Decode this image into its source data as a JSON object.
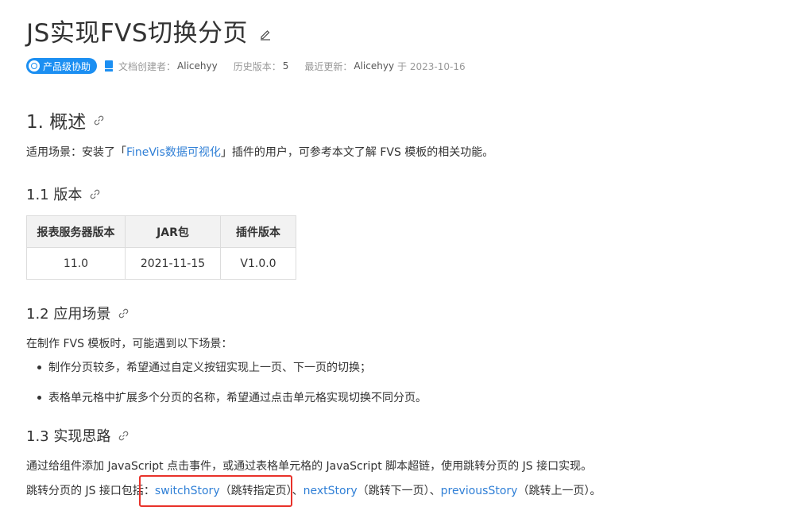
{
  "title": "JS实现FVS切换分页",
  "meta": {
    "badge": "产品级协助",
    "creator_label": "文档创建者：",
    "creator": "Alicehyy",
    "history_label": "历史版本：",
    "history": "5",
    "updated_label": "最近更新：",
    "updated_by": "Alicehyy",
    "updated_at": "于 2023-10-16"
  },
  "section1": {
    "heading": "1. 概述",
    "intro_prefix": "适用场景：安装了「",
    "intro_link": "FineVis数据可视化",
    "intro_suffix": "」插件的用户，可参考本文了解 FVS 模板的相关功能。"
  },
  "section1_1": {
    "heading": "1.1 版本",
    "table": {
      "headers": [
        "报表服务器版本",
        "JAR包",
        "插件版本"
      ],
      "rows": [
        [
          "11.0",
          "2021-11-15",
          "V1.0.0"
        ]
      ]
    }
  },
  "section1_2": {
    "heading": "1.2 应用场景",
    "intro": "在制作 FVS 模板时，可能遇到以下场景：",
    "items": [
      "制作分页较多，希望通过自定义按钮实现上一页、下一页的切换；",
      "表格单元格中扩展多个分页的名称，希望通过点击单元格实现切换不同分页。"
    ]
  },
  "section1_3": {
    "heading": "1.3 实现思路",
    "para1": "通过给组件添加 JavaScript 点击事件，或通过表格单元格的 JavaScript 脚本超链，使用跳转分页的 JS 接口实现。",
    "para2_prefix": "跳转分页的 JS 接口包括：",
    "api1": "switchStory",
    "api1_desc": "（跳转指定页）",
    "sep1": "、",
    "api2": "nextStory",
    "api2_desc": "（跳转下一页）",
    "sep2": "、",
    "api3": "previousStory",
    "api3_desc": "（跳转上一页）。"
  }
}
